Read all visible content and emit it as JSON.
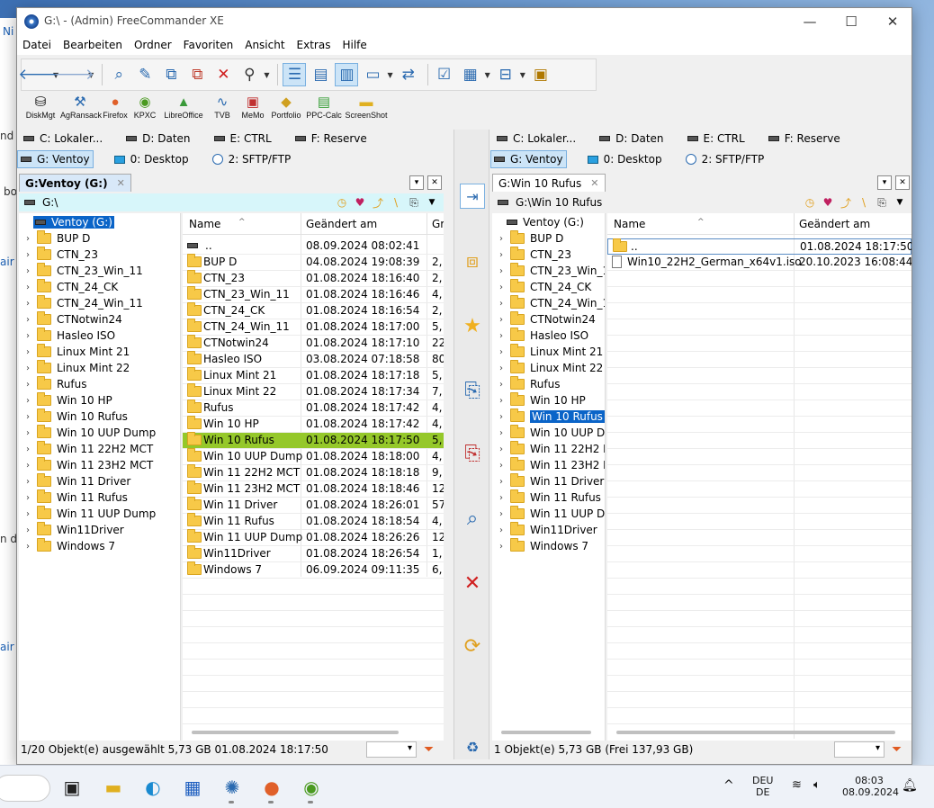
{
  "window": {
    "title": "G:\\ - (Admin) FreeCommander XE"
  },
  "menu": [
    "Datei",
    "Bearbeiten",
    "Ordner",
    "Favoriten",
    "Ansicht",
    "Extras",
    "Hilfe"
  ],
  "tools": [
    "DiskMgt",
    "AgRansack",
    "Firefox",
    "KPXC",
    "LibreOffice",
    "TVB",
    "MeMo",
    "Portfolio",
    "PPC-Calc",
    "ScreenShot"
  ],
  "drives_row1": [
    "C: Lokaler...",
    "D: Daten",
    "E: CTRL",
    "F: Reserve"
  ],
  "drives_row2": [
    "G: Ventoy",
    "0: Desktop",
    "2: SFTP/FTP"
  ],
  "background_fragments": [
    "Ni",
    "nd",
    "bo",
    "air",
    "n d",
    "air"
  ],
  "left": {
    "tab": "G:Ventoy (G:)",
    "path": "G:\\",
    "tree_root": "Ventoy (G:)",
    "tree": [
      "BUP D",
      "CTN_23",
      "CTN_23_Win_11",
      "CTN_24_CK",
      "CTN_24_Win_11",
      "CTNotwin24",
      "Hasleo ISO",
      "Linux Mint 21",
      "Linux Mint 22",
      "Rufus",
      "Win 10 HP",
      "Win 10 Rufus",
      "Win 10 UUP Dump",
      "Win 11 22H2 MCT",
      "Win 11 23H2 MCT",
      "Win 11 Driver",
      "Win 11 Rufus",
      "Win 11 UUP Dump",
      "Win11Driver",
      "Windows 7"
    ],
    "columns": {
      "name": "Name",
      "date": "Geändert am",
      "size": "Gr"
    },
    "files": [
      {
        "name": "..",
        "date": "08.09.2024 08:02:41",
        "size": ""
      },
      {
        "name": "BUP D",
        "date": "04.08.2024 19:08:39",
        "size": "2,"
      },
      {
        "name": "CTN_23",
        "date": "01.08.2024 18:16:40",
        "size": "2,"
      },
      {
        "name": "CTN_23_Win_11",
        "date": "01.08.2024 18:16:46",
        "size": "4,"
      },
      {
        "name": "CTN_24_CK",
        "date": "01.08.2024 18:16:54",
        "size": "2,"
      },
      {
        "name": "CTN_24_Win_11",
        "date": "01.08.2024 18:17:00",
        "size": "5,"
      },
      {
        "name": "CTNotwin24",
        "date": "01.08.2024 18:17:10",
        "size": "22"
      },
      {
        "name": "Hasleo ISO",
        "date": "03.08.2024 07:18:58",
        "size": "80"
      },
      {
        "name": "Linux Mint 21",
        "date": "01.08.2024 18:17:18",
        "size": "5,"
      },
      {
        "name": "Linux Mint 22",
        "date": "01.08.2024 18:17:34",
        "size": "7,"
      },
      {
        "name": "Rufus",
        "date": "01.08.2024 18:17:42",
        "size": "4,"
      },
      {
        "name": "Win 10 HP",
        "date": "01.08.2024 18:17:42",
        "size": "4,"
      },
      {
        "name": "Win 10 Rufus",
        "date": "01.08.2024 18:17:50",
        "size": "5,"
      },
      {
        "name": "Win 10 UUP Dump",
        "date": "01.08.2024 18:18:00",
        "size": "4,"
      },
      {
        "name": "Win 11 22H2 MCT",
        "date": "01.08.2024 18:18:18",
        "size": "9,"
      },
      {
        "name": "Win 11 23H2 MCT",
        "date": "01.08.2024 18:18:46",
        "size": "12"
      },
      {
        "name": "Win 11 Driver",
        "date": "01.08.2024 18:26:01",
        "size": "57"
      },
      {
        "name": "Win 11 Rufus",
        "date": "01.08.2024 18:18:54",
        "size": "4,"
      },
      {
        "name": "Win 11 UUP Dump",
        "date": "01.08.2024 18:26:26",
        "size": "12"
      },
      {
        "name": "Win11Driver",
        "date": "01.08.2024 18:26:54",
        "size": "1,"
      },
      {
        "name": "Windows 7",
        "date": "06.09.2024 09:11:35",
        "size": "6,"
      }
    ],
    "status": "1/20 Objekt(e) ausgewählt   5,73 GB   01.08.2024 18:17:50"
  },
  "right": {
    "tab": "G:Win 10 Rufus",
    "path": "G:\\Win 10 Rufus",
    "tree_root": "Ventoy (G:)",
    "tree": [
      "BUP D",
      "CTN_23",
      "CTN_23_Win_1",
      "CTN_24_CK",
      "CTN_24_Win_1",
      "CTNotwin24",
      "Hasleo ISO",
      "Linux Mint 21",
      "Linux Mint 22",
      "Rufus",
      "Win 10 HP",
      "Win 10 Rufus",
      "Win 10 UUP Du",
      "Win 11 22H2 M",
      "Win 11 23H2 M",
      "Win 11 Driver",
      "Win 11 Rufus",
      "Win 11 UUP Du",
      "Win11Driver",
      "Windows 7"
    ],
    "columns": {
      "name": "Name",
      "date": "Geändert am"
    },
    "files": [
      {
        "name": "..",
        "date": "01.08.2024 18:17:50"
      },
      {
        "name": "Win10_22H2_German_x64v1.iso",
        "date": "20.10.2023 16:08:44"
      }
    ],
    "status": "1 Objekt(e)   5,73 GB   (Frei 137,93 GB)"
  },
  "taskbar": {
    "lang1": "DEU",
    "lang2": "DE",
    "time": "08:03",
    "date": "08.09.2024"
  }
}
